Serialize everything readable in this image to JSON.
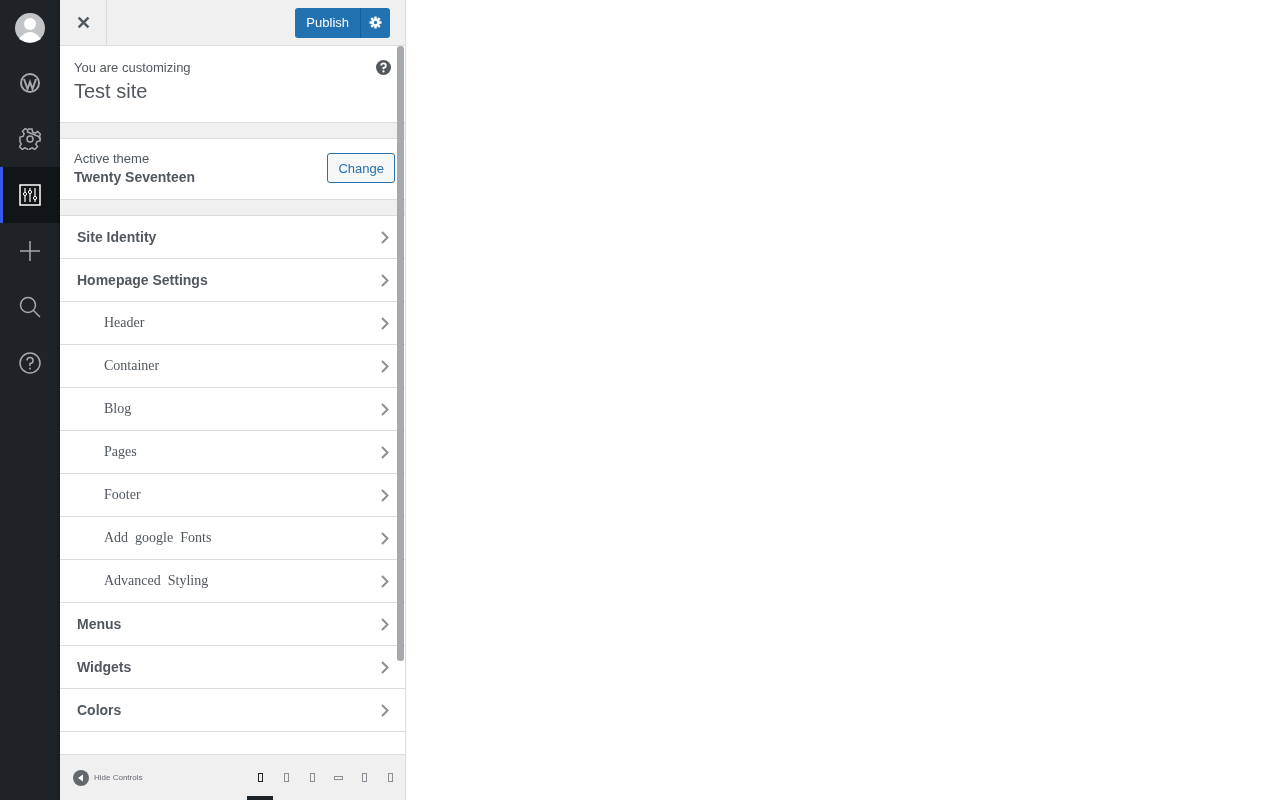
{
  "rail": [
    {
      "kind": "avatar",
      "selected": false
    },
    {
      "kind": "wordpress",
      "selected": false
    },
    {
      "kind": "gear",
      "selected": false
    },
    {
      "kind": "sliders",
      "selected": true
    },
    {
      "kind": "plus",
      "selected": false
    },
    {
      "kind": "search",
      "selected": false
    },
    {
      "kind": "help",
      "selected": false
    }
  ],
  "header": {
    "close": "✕",
    "publish": "Publish"
  },
  "info": {
    "label": "You are customizing",
    "title": "Test site"
  },
  "theme": {
    "label": "Active theme",
    "name": "Twenty Seventeen",
    "button": "Change"
  },
  "sections": [
    {
      "kind": "section",
      "label": "Site Identity"
    },
    {
      "kind": "section",
      "label": "Homepage Settings"
    },
    {
      "kind": "sub",
      "label": "Header"
    },
    {
      "kind": "sub",
      "label": "Container"
    },
    {
      "kind": "sub",
      "label": "Blog"
    },
    {
      "kind": "sub",
      "label": "Pages"
    },
    {
      "kind": "sub",
      "label": "Footer"
    },
    {
      "kind": "sub",
      "label": "Add  google  Fonts"
    },
    {
      "kind": "sub",
      "label": "Advanced  Styling"
    },
    {
      "kind": "section",
      "label": "Menus"
    },
    {
      "kind": "section",
      "label": "Widgets"
    },
    {
      "kind": "section",
      "label": "Colors"
    }
  ],
  "footer": {
    "hide": "Hide Controls",
    "devices": [
      {
        "selected": true
      },
      {
        "selected": false
      },
      {
        "selected": false
      },
      {
        "selected": false
      },
      {
        "selected": false
      },
      {
        "selected": false
      }
    ]
  }
}
